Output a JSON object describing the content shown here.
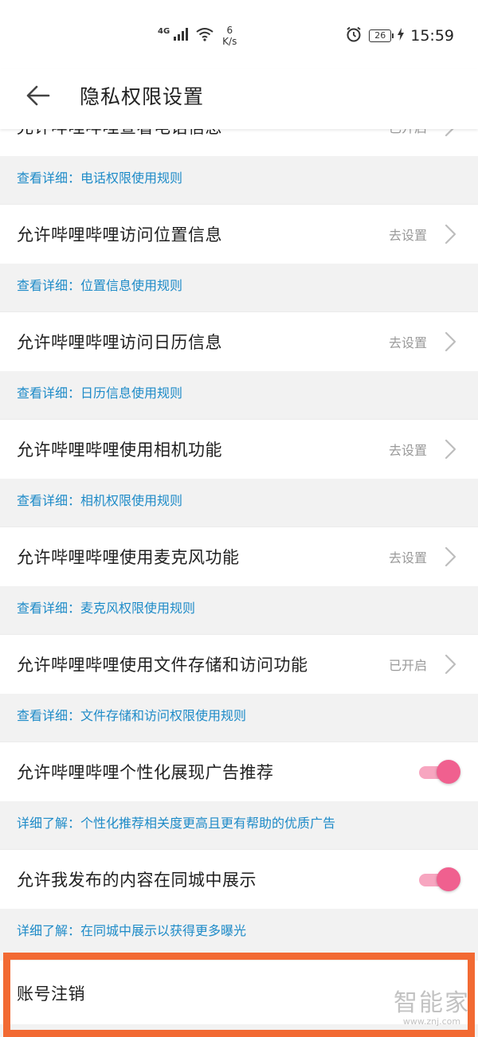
{
  "statusbar": {
    "network": "4G",
    "speed_value": "6",
    "speed_unit": "K/s",
    "battery": "26",
    "time": "15:59"
  },
  "header": {
    "title": "隐私权限设置"
  },
  "permissions": [
    {
      "title": "允许哔哩哔哩查看电话信息",
      "status": "已开启",
      "detail": "查看详细：电话权限使用规则",
      "control": "chevron"
    },
    {
      "title": "允许哔哩哔哩访问位置信息",
      "status": "去设置",
      "detail": "查看详细：位置信息使用规则",
      "control": "chevron"
    },
    {
      "title": "允许哔哩哔哩访问日历信息",
      "status": "去设置",
      "detail": "查看详细：日历信息使用规则",
      "control": "chevron"
    },
    {
      "title": "允许哔哩哔哩使用相机功能",
      "status": "去设置",
      "detail": "查看详细：相机权限使用规则",
      "control": "chevron"
    },
    {
      "title": "允许哔哩哔哩使用麦克风功能",
      "status": "去设置",
      "detail": "查看详细：麦克风权限使用规则",
      "control": "chevron"
    },
    {
      "title": "允许哔哩哔哩使用文件存储和访问功能",
      "status": "已开启",
      "detail": "查看详细：文件存储和访问权限使用规则",
      "control": "chevron"
    },
    {
      "title": "允许哔哩哔哩个性化展现广告推荐",
      "status": "",
      "detail": "详细了解：个性化推荐相关度更高且更有帮助的优质广告",
      "control": "toggle",
      "enabled": true
    },
    {
      "title": "允许我发布的内容在同城中展示",
      "status": "",
      "detail": "详细了解：在同城中展示以获得更多曝光",
      "control": "toggle",
      "enabled": true
    }
  ],
  "account": {
    "label": "账号注销"
  },
  "watermark": {
    "name": "智能家",
    "url": "www.znj.com"
  },
  "colors": {
    "link": "#1e8bc8",
    "toggle_on": "#f0608f",
    "highlight": "#f26a33"
  }
}
